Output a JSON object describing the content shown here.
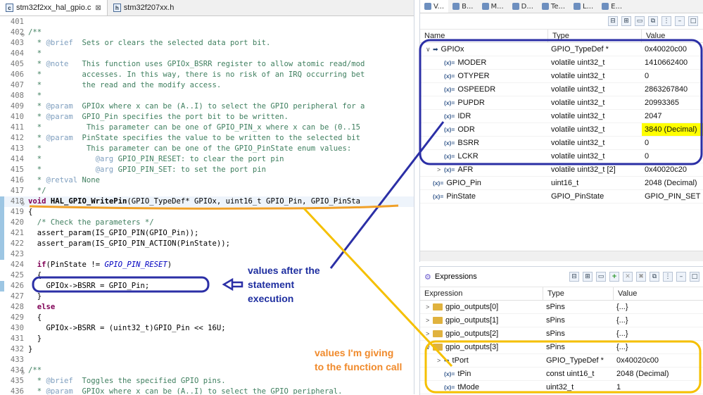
{
  "editor": {
    "tabs": [
      {
        "label": "stm32f2xx_hal_gpio.c",
        "icon": "c-file-icon",
        "close": "⊠"
      },
      {
        "label": "stm32f207xx.h",
        "icon": "h-file-icon",
        "close": ""
      }
    ],
    "lines": [
      {
        "n": "401",
        "t": ""
      },
      {
        "n": "402",
        "t": "/**"
      },
      {
        "n": "403",
        "t": "  * @brief  Sets or clears the selected data port bit."
      },
      {
        "n": "404",
        "t": "  *"
      },
      {
        "n": "405",
        "t": "  * @note   This function uses GPIOx_BSRR register to allow atomic read/mod"
      },
      {
        "n": "406",
        "t": "  *         accesses. In this way, there is no risk of an IRQ occurring bet"
      },
      {
        "n": "407",
        "t": "  *         the read and the modify access."
      },
      {
        "n": "408",
        "t": "  *"
      },
      {
        "n": "409",
        "t": "  * @param  GPIOx where x can be (A..I) to select the GPIO peripheral for a"
      },
      {
        "n": "410",
        "t": "  * @param  GPIO_Pin specifies the port bit to be written."
      },
      {
        "n": "411",
        "t": "  *          This parameter can be one of GPIO_PIN_x where x can be (0..15"
      },
      {
        "n": "412",
        "t": "  * @param  PinState specifies the value to be written to the selected bit"
      },
      {
        "n": "413",
        "t": "  *          This parameter can be one of the GPIO_PinState enum values:"
      },
      {
        "n": "414",
        "t": "  *            @arg GPIO_PIN_RESET: to clear the port pin"
      },
      {
        "n": "415",
        "t": "  *            @arg GPIO_PIN_SET: to set the port pin"
      },
      {
        "n": "416",
        "t": "  * @retval None"
      },
      {
        "n": "417",
        "t": "  */"
      },
      {
        "n": "418",
        "t": "void HAL_GPIO_WritePin(GPIO_TypeDef* GPIOx, uint16_t GPIO_Pin, GPIO_PinSta"
      },
      {
        "n": "419",
        "t": "{"
      },
      {
        "n": "420",
        "t": "  /* Check the parameters */"
      },
      {
        "n": "421",
        "t": "  assert_param(IS_GPIO_PIN(GPIO_Pin));"
      },
      {
        "n": "422",
        "t": "  assert_param(IS_GPIO_PIN_ACTION(PinState));"
      },
      {
        "n": "423",
        "t": ""
      },
      {
        "n": "424",
        "t": "  if(PinState != GPIO_PIN_RESET)"
      },
      {
        "n": "425",
        "t": "  {"
      },
      {
        "n": "426",
        "t": "    GPIOx->BSRR = GPIO_Pin;"
      },
      {
        "n": "427",
        "t": "  }"
      },
      {
        "n": "428",
        "t": "  else"
      },
      {
        "n": "429",
        "t": "  {"
      },
      {
        "n": "430",
        "t": "    GPIOx->BSRR = (uint32_t)GPIO_Pin << 16U;"
      },
      {
        "n": "431",
        "t": "  }"
      },
      {
        "n": "432",
        "t": "}"
      },
      {
        "n": "433",
        "t": ""
      },
      {
        "n": "434",
        "t": "/**"
      },
      {
        "n": "435",
        "t": "  * @brief  Toggles the specified GPIO pins."
      },
      {
        "n": "436",
        "t": "  * @param  GPIOx where x can be (A..I) to select the GPIO peripheral."
      }
    ]
  },
  "variables_panel": {
    "tabs": [
      {
        "label": "V...",
        "icon": "variables-icon"
      },
      {
        "label": "B...",
        "icon": "breakpoints-icon"
      },
      {
        "label": "M...",
        "icon": "modules-icon"
      },
      {
        "label": "D...",
        "icon": "disassembly-icon"
      },
      {
        "label": "Te...",
        "icon": "terminal-icon"
      },
      {
        "label": "L...",
        "icon": "live-expressions-icon"
      },
      {
        "label": "E...",
        "icon": "expressions-icon"
      }
    ],
    "columns": [
      "Name",
      "Type",
      "Value"
    ],
    "rows": [
      {
        "name": "GPIOx",
        "type": "GPIO_TypeDef *",
        "value": "0x40020c00",
        "icon": "pointer-icon",
        "expander": "∨",
        "level": 0
      },
      {
        "name": "MODER",
        "type": "volatile uint32_t",
        "value": "1410662400",
        "icon": "variable-icon",
        "expander": "",
        "level": 1
      },
      {
        "name": "OTYPER",
        "type": "volatile uint32_t",
        "value": "0",
        "icon": "variable-icon",
        "expander": "",
        "level": 1
      },
      {
        "name": "OSPEEDR",
        "type": "volatile uint32_t",
        "value": "2863267840",
        "icon": "variable-icon",
        "expander": "",
        "level": 1
      },
      {
        "name": "PUPDR",
        "type": "volatile uint32_t",
        "value": "20993365",
        "icon": "variable-icon",
        "expander": "",
        "level": 1
      },
      {
        "name": "IDR",
        "type": "volatile uint32_t",
        "value": "2047",
        "icon": "variable-icon",
        "expander": "",
        "level": 1
      },
      {
        "name": "ODR",
        "type": "volatile uint32_t",
        "value": "3840 (Decimal)",
        "icon": "variable-icon",
        "expander": "",
        "level": 1,
        "highlight": true
      },
      {
        "name": "BSRR",
        "type": "volatile uint32_t",
        "value": "0",
        "icon": "variable-icon",
        "expander": "",
        "level": 1
      },
      {
        "name": "LCKR",
        "type": "volatile uint32_t",
        "value": "0",
        "icon": "variable-icon",
        "expander": "",
        "level": 1
      },
      {
        "name": "AFR",
        "type": "volatile uint32_t [2]",
        "value": "0x40020c20",
        "icon": "variable-icon",
        "expander": ">",
        "level": 1
      },
      {
        "name": "GPIO_Pin",
        "type": "uint16_t",
        "value": "2048 (Decimal)",
        "icon": "variable-icon",
        "expander": "",
        "level": 0
      },
      {
        "name": "PinState",
        "type": "GPIO_PinState",
        "value": "GPIO_PIN_SET",
        "icon": "variable-icon",
        "expander": "",
        "level": 0
      }
    ]
  },
  "expressions_panel": {
    "title": "Expressions",
    "columns": [
      "Expression",
      "Type",
      "Value"
    ],
    "rows": [
      {
        "name": "gpio_outputs[0]",
        "type": "sPins",
        "value": "{...}",
        "icon": "struct-icon",
        "expander": ">",
        "level": 0
      },
      {
        "name": "gpio_outputs[1]",
        "type": "sPins",
        "value": "{...}",
        "icon": "struct-icon",
        "expander": ">",
        "level": 0
      },
      {
        "name": "gpio_outputs[2]",
        "type": "sPins",
        "value": "{...}",
        "icon": "struct-icon",
        "expander": ">",
        "level": 0
      },
      {
        "name": "gpio_outputs[3]",
        "type": "sPins",
        "value": "{...}",
        "icon": "struct-icon",
        "expander": "∨",
        "level": 0
      },
      {
        "name": "tPort",
        "type": "GPIO_TypeDef *",
        "value": "0x40020c00",
        "icon": "pointer-icon",
        "expander": ">",
        "level": 1
      },
      {
        "name": "tPin",
        "type": "const uint16_t",
        "value": "2048 (Decimal)",
        "icon": "variable-icon",
        "expander": "",
        "level": 1
      },
      {
        "name": "tMode",
        "type": "uint32_t",
        "value": "1",
        "icon": "variable-icon",
        "expander": "",
        "level": 1
      }
    ]
  },
  "annotations": {
    "blue_label": [
      "values after the",
      "statement",
      "execution"
    ],
    "orange_label": [
      "values I'm giving",
      "to the function call"
    ],
    "blue_color": "#2b2fa6",
    "orange_color": "#f0a028",
    "yellow_color": "#f5c000"
  },
  "icons": {
    "variable": "(x)=",
    "pointer": "➡",
    "pointer_alt": "◆"
  }
}
